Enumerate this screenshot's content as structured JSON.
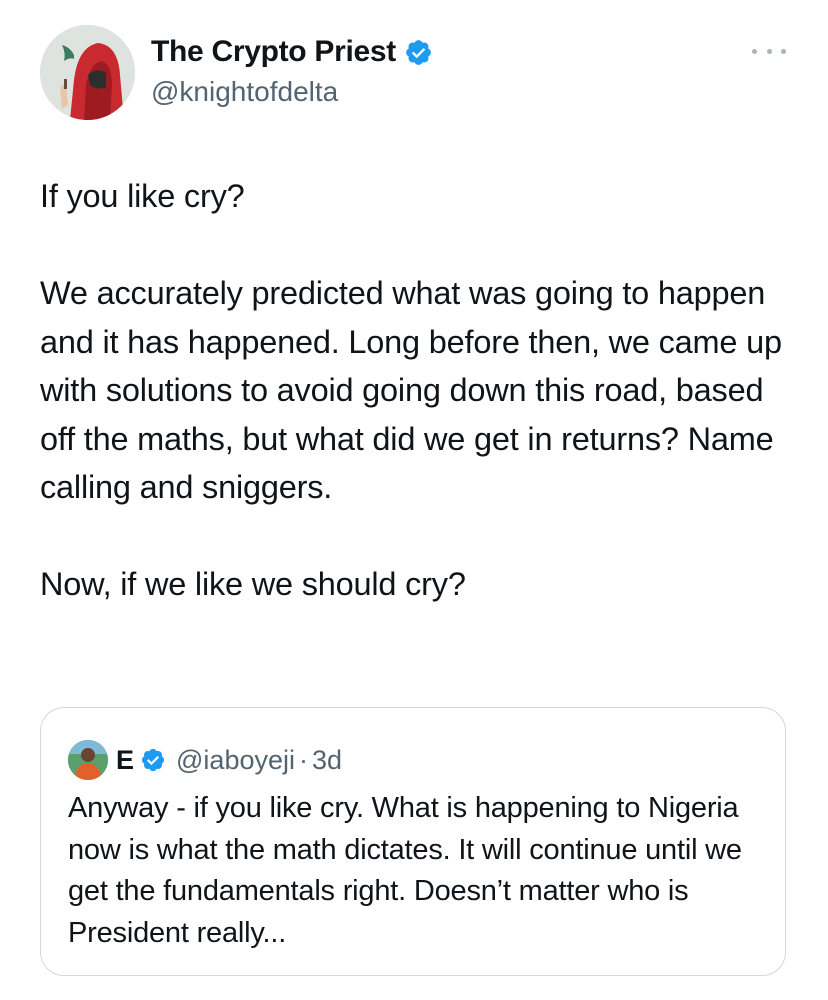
{
  "author": {
    "name": "The Crypto Priest",
    "handle": "@knightofdelta",
    "verified": true,
    "avatar_icon": "red-hooded-figure-avatar"
  },
  "more_icon": "more-options-icon",
  "tweet": {
    "paragraphs": [
      "If you like cry?",
      "We accurately predicted what was going to happen and it has happened. Long before then, we came up with solutions to avoid going down this road, based off the maths, but what did we get in returns? Name calling and sniggers.",
      "Now, if we like we should cry?"
    ]
  },
  "quoted_tweet": {
    "name": "E",
    "handle": "@iaboyeji",
    "separator": "·",
    "time": "3d",
    "verified": true,
    "text": "Anyway - if you like cry. What is happening to Nigeria now is what the math dictates. It will continue until we get the fundamentals right. Doesn’t matter who is President really..."
  },
  "colors": {
    "text": "#0f1419",
    "secondary": "#536471",
    "verified_blue": "#1d9bf0",
    "border": "#cfd9de"
  }
}
